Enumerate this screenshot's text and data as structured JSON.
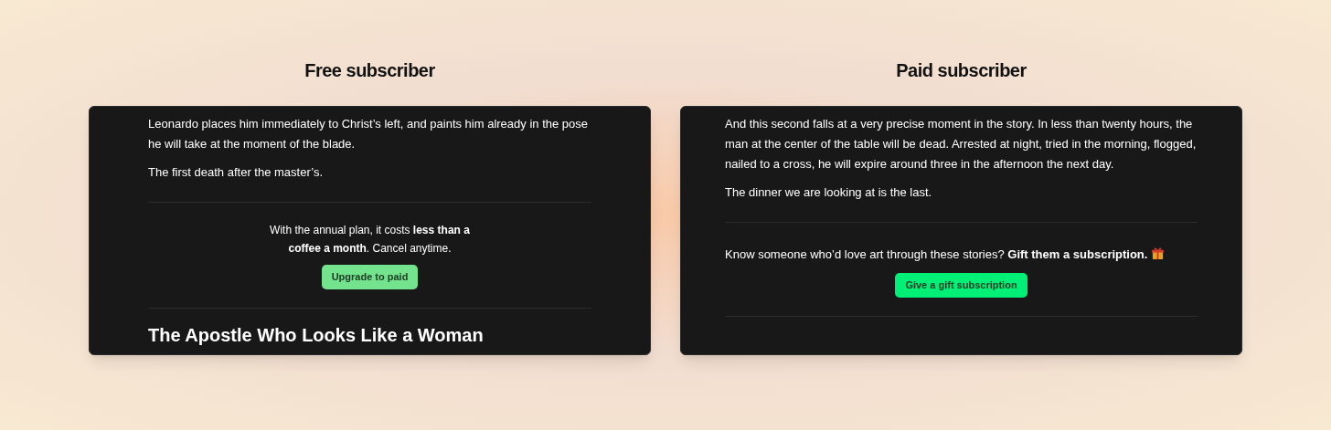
{
  "panels": [
    {
      "title": "Free subscriber",
      "blocks": [
        {
          "kind": "paragraph",
          "text": "Leonardo places him immediately to Christ’s left, and paints him already in the pose he will take at the moment of the blade."
        },
        {
          "kind": "paragraph",
          "text": "The first death after the master’s."
        },
        {
          "kind": "divider"
        },
        {
          "kind": "promo",
          "text": "With the annual plan, it costs **less than a coffee a month**. Cancel anytime.",
          "gift_icon": false
        },
        {
          "kind": "button",
          "label": "Upgrade to paid",
          "color": "#74e38e"
        },
        {
          "kind": "divider"
        },
        {
          "kind": "heading",
          "text": "The Apostle Who Looks Like a Woman"
        }
      ]
    },
    {
      "title": "Paid subscriber",
      "blocks": [
        {
          "kind": "paragraph",
          "text": "And this second falls at a very precise moment in the story. In less than twenty hours, the man at the center of the table will be dead. Arrested at night, tried in the morning, flogged, nailed to a cross, he will expire around three in the afternoon the next day."
        },
        {
          "kind": "paragraph",
          "text": "The dinner we are looking at is the last."
        },
        {
          "kind": "divider"
        },
        {
          "kind": "note",
          "text": "Know someone who’d love art through these stories? **Gift them a subscription.**",
          "gift_icon": true
        },
        {
          "kind": "button",
          "label": "Give a gift subscription",
          "color": "#00ef77"
        },
        {
          "kind": "divider"
        }
      ]
    }
  ]
}
